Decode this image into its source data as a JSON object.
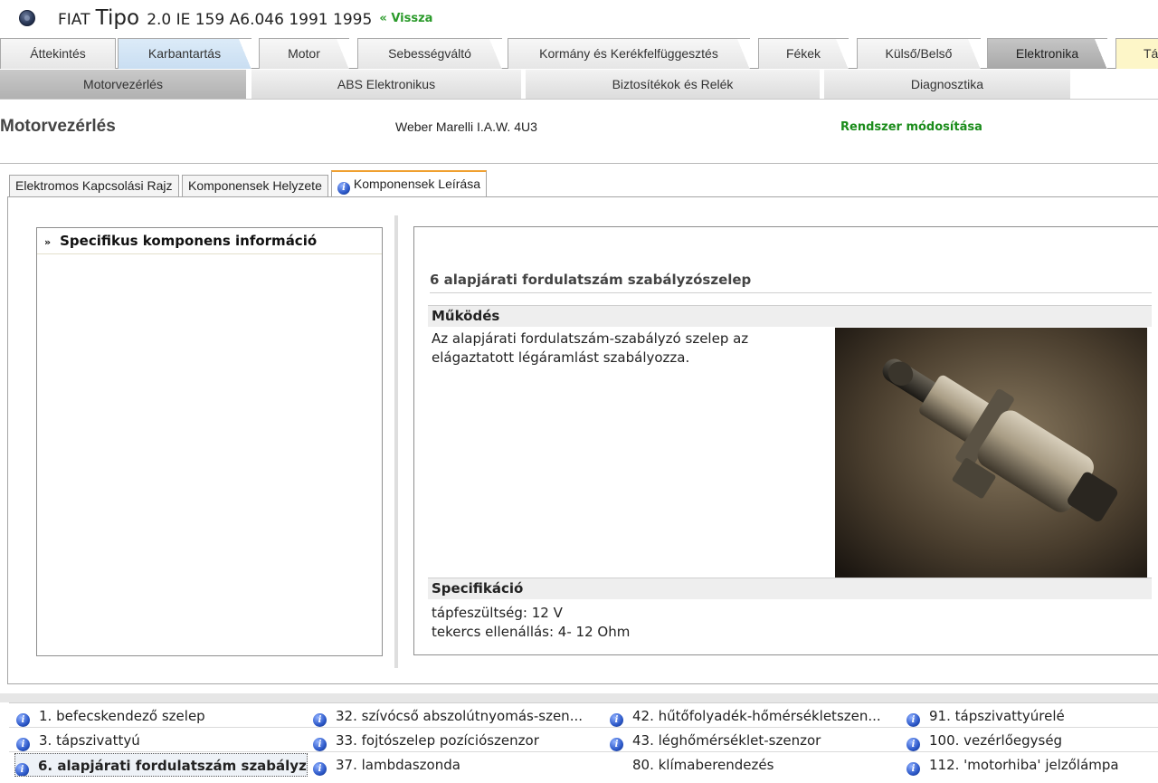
{
  "header": {
    "make": "FIAT",
    "model": "Tipo",
    "engine": "2.0 IE 159 A6.046 1991 1995",
    "back_link": "« Vissza"
  },
  "top_tabs": [
    {
      "label": "Áttekintés"
    },
    {
      "label": "Karbantartás"
    },
    {
      "label": "Motor"
    },
    {
      "label": "Sebességváltó"
    },
    {
      "label": "Kormány és Kerékfelfüggesztés"
    },
    {
      "label": "Fékek"
    },
    {
      "label": "Külső/Belső"
    },
    {
      "label": "Elektronika"
    },
    {
      "label": "Tá"
    }
  ],
  "sub_tabs": [
    {
      "label": "Motorvezérlés"
    },
    {
      "label": "ABS Elektronikus"
    },
    {
      "label": "Biztosítékok és Relék"
    },
    {
      "label": "Diagnosztika"
    }
  ],
  "section": {
    "title": "Motorvezérlés",
    "system": "Weber Marelli I.A.W. 4U3",
    "modify_link": "Rendszer módosítása"
  },
  "component_tabs": [
    {
      "label": "Elektromos Kapcsolási Rajz"
    },
    {
      "label": "Komponensek Helyzete"
    },
    {
      "label": "Komponensek Leírása"
    }
  ],
  "left_panel": {
    "heading": "Specifikus komponens információ"
  },
  "component": {
    "title": "6  alapjárati fordulatszám szabályzószelep",
    "operation_heading": "Működés",
    "operation_text": "Az alapjárati fordulatszám-szabályzó szelep az elágaztatott légáramlást szabályozza.",
    "spec_heading": "Specifikáció",
    "spec_lines": [
      "tápfeszültség: 12 V",
      "tekercs ellenállás: 4- 12 Ohm"
    ]
  },
  "component_list": [
    {
      "label": "1. befecskendező szelep",
      "icon": true
    },
    {
      "label": "3. tápszivattyú",
      "icon": true
    },
    {
      "label": "6. alapjárati fordulatszám szabályz...",
      "icon": true,
      "selected": true
    },
    {
      "label": "32. szívócső abszolútnyomás-szen...",
      "icon": true
    },
    {
      "label": "33. fojtószelep pozíciószenzor",
      "icon": true
    },
    {
      "label": "37. lambdaszonda",
      "icon": true
    },
    {
      "label": "42. hűtőfolyadék-hőmérsékletszen...",
      "icon": true
    },
    {
      "label": "43. léghőmérséklet-szenzor",
      "icon": true
    },
    {
      "label": "80. klímaberendezés",
      "icon": false
    },
    {
      "label": "91. tápszivattyúrelé",
      "icon": true
    },
    {
      "label": "100. vezérlőegység",
      "icon": true
    },
    {
      "label": "112. 'motorhiba' jelzőlámpa",
      "icon": true
    }
  ],
  "icons": {
    "logo": "fiat-logo-icon",
    "info": "info-icon",
    "chevron": "double-chevron-right-icon"
  },
  "colors": {
    "link_green": "#1b8c1b",
    "active_tab_blue": "#c9def2",
    "active_tab_border": "#f0a030"
  }
}
